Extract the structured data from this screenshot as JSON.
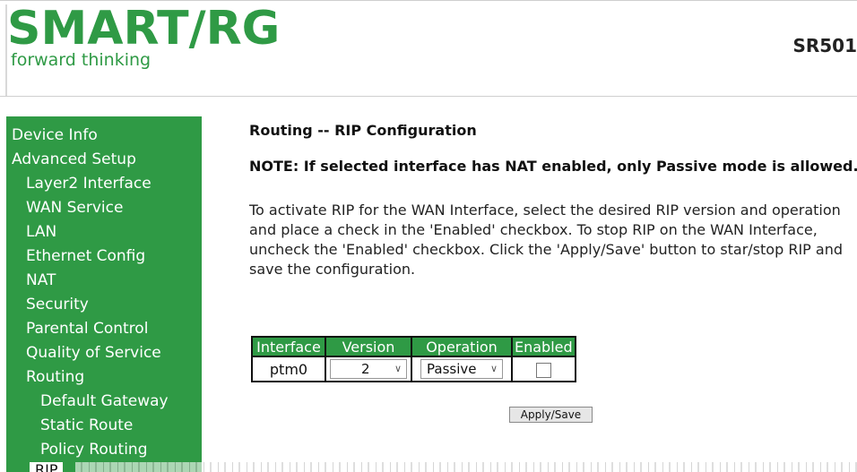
{
  "brand": {
    "logo_text": "SMART/RG",
    "reg_mark": "®",
    "tagline": "forward thinking",
    "model": "SR501"
  },
  "colors": {
    "accent": "#2f9a45"
  },
  "sidebar": {
    "items": [
      {
        "label": "Device Info",
        "level": 0
      },
      {
        "label": "Advanced Setup",
        "level": 0
      },
      {
        "label": "Layer2 Interface",
        "level": 1
      },
      {
        "label": "WAN Service",
        "level": 1
      },
      {
        "label": "LAN",
        "level": 1
      },
      {
        "label": "Ethernet Config",
        "level": 1
      },
      {
        "label": "NAT",
        "level": 1
      },
      {
        "label": "Security",
        "level": 1
      },
      {
        "label": "Parental Control",
        "level": 1
      },
      {
        "label": "Quality of Service",
        "level": 1
      },
      {
        "label": "Routing",
        "level": 1
      },
      {
        "label": "Default Gateway",
        "level": 2
      },
      {
        "label": "Static Route",
        "level": 2
      },
      {
        "label": "Policy Routing",
        "level": 2
      }
    ],
    "current": "RIP"
  },
  "main": {
    "title": "Routing -- RIP Configuration",
    "note": "NOTE: If selected interface has NAT enabled, only Passive mode is allowed.",
    "description": "To activate RIP for the WAN Interface, select the desired RIP version and operation and place a check in the 'Enabled' checkbox. To stop RIP on the WAN Interface, uncheck the 'Enabled' checkbox. Click the 'Apply/Save' button to star/stop RIP and save the configuration.",
    "table": {
      "headers": [
        "Interface",
        "Version",
        "Operation",
        "Enabled"
      ],
      "row": {
        "interface": "ptm0",
        "version": "2",
        "operation": "Passive",
        "enabled": false
      }
    },
    "apply_label": "Apply/Save"
  }
}
